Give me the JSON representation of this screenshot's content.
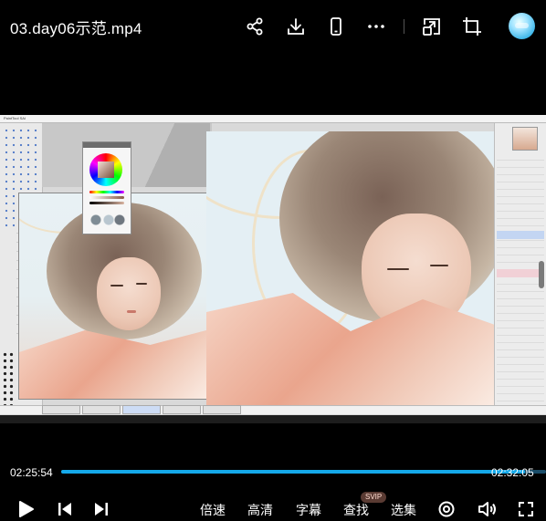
{
  "header": {
    "title": "03.day06示范.mp4",
    "icons": [
      "share-icon",
      "download-icon",
      "phone-icon",
      "more-icon",
      "picture-in-picture-icon",
      "crop-icon",
      "avatar"
    ]
  },
  "video": {
    "content": "painting-software-screen-recording",
    "source_titlebar": "PaintTool SAI"
  },
  "player": {
    "current_time": "02:25:54",
    "total_time": "02:32:05",
    "progress_percent": 95.7,
    "accent_color": "#15a9ea",
    "controls": {
      "play_icon": "play-icon",
      "prev_icon": "previous-icon",
      "next_icon": "next-icon",
      "speed_label": "倍速",
      "quality_label": "高清",
      "subtitle_label": "字幕",
      "search_label": "查找",
      "search_badge": "SVIP",
      "episodes_label": "选集",
      "settings_icon": "settings-icon",
      "volume_icon": "volume-icon",
      "fullscreen_icon": "fullscreen-icon"
    }
  }
}
